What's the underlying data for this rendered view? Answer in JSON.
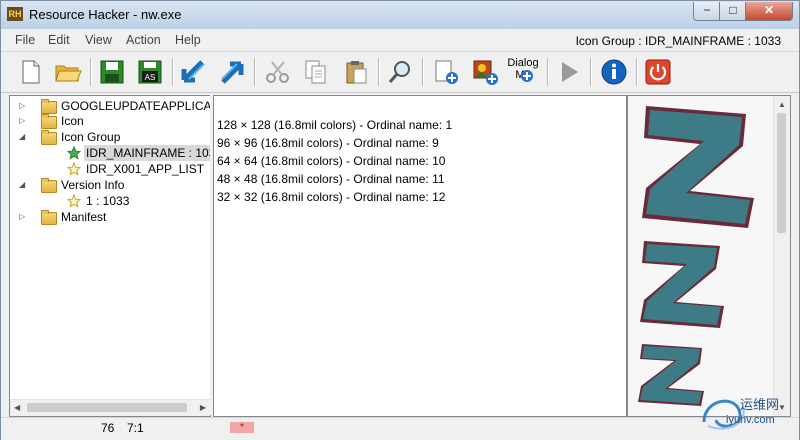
{
  "window": {
    "title": "Resource Hacker - nw.exe",
    "app_icon_text": "RH"
  },
  "window_buttons": {
    "minimize": "−",
    "maximize": "□",
    "close": "✕"
  },
  "menu": {
    "items": [
      "File",
      "Edit",
      "View",
      "Action",
      "Help"
    ],
    "status": "Icon Group : IDR_MAINFRAME : 1033"
  },
  "toolbar": {
    "buttons": [
      {
        "icon": "new-file-icon"
      },
      {
        "icon": "open-folder-icon"
      },
      {
        "icon": "save-icon"
      },
      {
        "icon": "save-as-icon",
        "label": "AS"
      },
      {
        "icon": "back-arrow-icon"
      },
      {
        "icon": "forward-arrow-icon"
      },
      {
        "icon": "cut-icon"
      },
      {
        "icon": "copy-icon"
      },
      {
        "icon": "paste-icon"
      },
      {
        "icon": "search-icon"
      },
      {
        "icon": "add-resource-icon"
      },
      {
        "icon": "add-image-resource-icon"
      },
      {
        "icon": "dialog-menu-icon",
        "label": "Dialog Me"
      },
      {
        "icon": "compile-run-icon"
      },
      {
        "icon": "info-icon"
      },
      {
        "icon": "power-icon"
      }
    ]
  },
  "tree": {
    "items": [
      {
        "label": "GOOGLEUPDATEAPPLICAT",
        "expander": "▷"
      },
      {
        "label": "Icon",
        "expander": "▷"
      },
      {
        "label": "Icon Group",
        "expander": "◢"
      },
      {
        "label": "IDR_MAINFRAME : 103",
        "selected": true
      },
      {
        "label": "IDR_X001_APP_LIST"
      },
      {
        "label": "Version Info",
        "expander": "◢"
      },
      {
        "label": "1 : 1033"
      },
      {
        "label": "Manifest",
        "expander": "▷"
      }
    ]
  },
  "content": {
    "lines": [
      "128 × 128 (16.8mil colors) - Ordinal name: 1",
      "96 × 96 (16.8mil colors) - Ordinal name: 9",
      "64 × 64 (16.8mil colors) - Ordinal name: 10",
      "48 × 48 (16.8mil colors) - Ordinal name: 11",
      "32 × 32 (16.8mil colors) - Ordinal name: 12"
    ]
  },
  "status": {
    "position": "76",
    "cursor": "7:1",
    "modified": "*"
  },
  "watermark": {
    "text_cn": "运维网",
    "text_url": "iyunv.com"
  },
  "colors": {
    "icon_fill": "#3d7b86",
    "icon_outline": "#6b2a39",
    "accent": "#1565c0"
  }
}
